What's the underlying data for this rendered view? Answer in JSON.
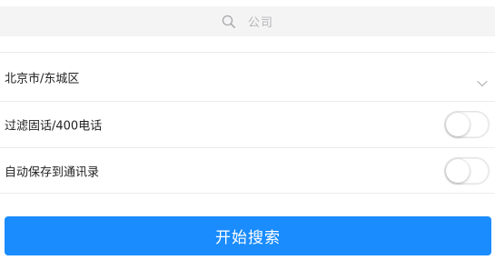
{
  "colors": {
    "accent": "#1a8cfe",
    "search_bg": "#f4f4f5",
    "placeholder": "#b5b5b8",
    "divider": "#ececec"
  },
  "search": {
    "icon": "search-icon",
    "placeholder": "公司"
  },
  "region": {
    "value": "北京市/东城区",
    "icon": "chevron-down-icon"
  },
  "filters": {
    "filter_landline": {
      "label": "过滤固话/400电话",
      "enabled": false
    },
    "auto_save": {
      "label": "自动保存到通讯录",
      "enabled": false
    }
  },
  "actions": {
    "start_search": "开始搜索"
  }
}
